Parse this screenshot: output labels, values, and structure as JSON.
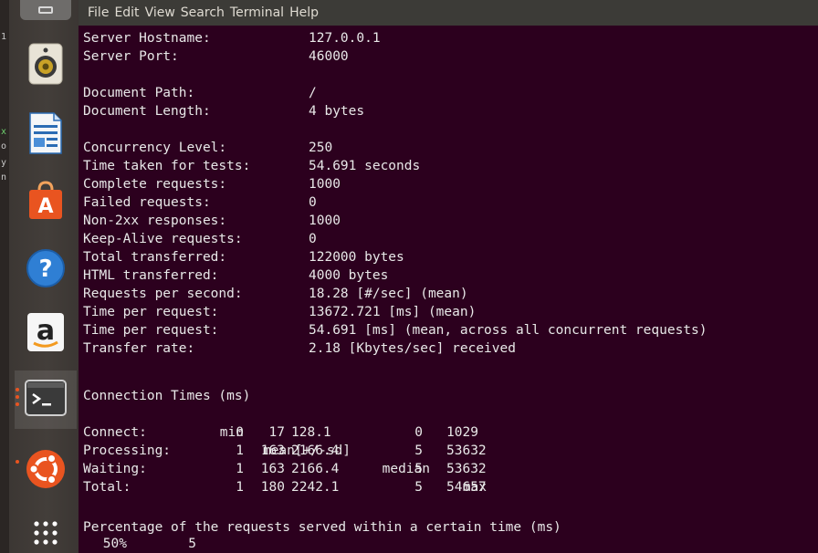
{
  "menubar": {
    "items": [
      "File",
      "Edit",
      "View",
      "Search",
      "Terminal",
      "Help"
    ]
  },
  "launcher": {
    "items": [
      {
        "name": "Rhythmbox",
        "icon": "speaker-icon"
      },
      {
        "name": "LibreOffice Writer",
        "icon": "document-icon"
      },
      {
        "name": "Ubuntu Software",
        "icon": "shopping-bag-icon"
      },
      {
        "name": "Help",
        "icon": "help-icon"
      },
      {
        "name": "Amazon",
        "icon": "amazon-icon"
      },
      {
        "name": "Terminal",
        "icon": "terminal-icon"
      },
      {
        "name": "Ubuntu",
        "icon": "ubuntu-logo-icon"
      },
      {
        "name": "Show Applications",
        "icon": "app-grid-icon"
      }
    ]
  },
  "terminal": {
    "stats": [
      {
        "label": "Server Hostname:",
        "value": "127.0.0.1"
      },
      {
        "label": "Server Port:",
        "value": "46000"
      },
      {
        "label": "",
        "value": ""
      },
      {
        "label": "Document Path:",
        "value": "/"
      },
      {
        "label": "Document Length:",
        "value": "4 bytes"
      },
      {
        "label": "",
        "value": ""
      },
      {
        "label": "Concurrency Level:",
        "value": "250"
      },
      {
        "label": "Time taken for tests:",
        "value": "54.691 seconds"
      },
      {
        "label": "Complete requests:",
        "value": "1000"
      },
      {
        "label": "Failed requests:",
        "value": "0"
      },
      {
        "label": "Non-2xx responses:",
        "value": "1000"
      },
      {
        "label": "Keep-Alive requests:",
        "value": "0"
      },
      {
        "label": "Total transferred:",
        "value": "122000 bytes"
      },
      {
        "label": "HTML transferred:",
        "value": "4000 bytes"
      },
      {
        "label": "Requests per second:",
        "value": "18.28 [#/sec] (mean)"
      },
      {
        "label": "Time per request:",
        "value": "13672.721 [ms] (mean)"
      },
      {
        "label": "Time per request:",
        "value": "54.691 [ms] (mean, across all concurrent requests)"
      },
      {
        "label": "Transfer rate:",
        "value": "2.18 [Kbytes/sec] received"
      }
    ],
    "connection_title": "Connection Times (ms)",
    "connection_header": [
      "min",
      "mean[+/-sd]",
      "median",
      "max"
    ],
    "connection_rows": [
      {
        "label": "Connect:",
        "min": "0",
        "mean": "17",
        "sd": "128.1",
        "median": "0",
        "max": "1029"
      },
      {
        "label": "Processing:",
        "min": "1",
        "mean": "163",
        "sd": "2166.4",
        "median": "5",
        "max": "53632"
      },
      {
        "label": "Waiting:",
        "min": "1",
        "mean": "163",
        "sd": "2166.4",
        "median": "5",
        "max": "53632"
      },
      {
        "label": "Total:",
        "min": "1",
        "mean": "180",
        "sd": "2242.1",
        "median": "5",
        "max": "54657"
      }
    ],
    "percentage_title": "Percentage of the requests served within a certain time (ms)",
    "percentages": [
      {
        "pct": "50%",
        "ms": "5"
      }
    ]
  },
  "colors": {
    "terminal_bg": "#2c001e",
    "text": "#e8e8e8",
    "menubar_bg": "#3c3b37",
    "accent": "#e95420"
  }
}
